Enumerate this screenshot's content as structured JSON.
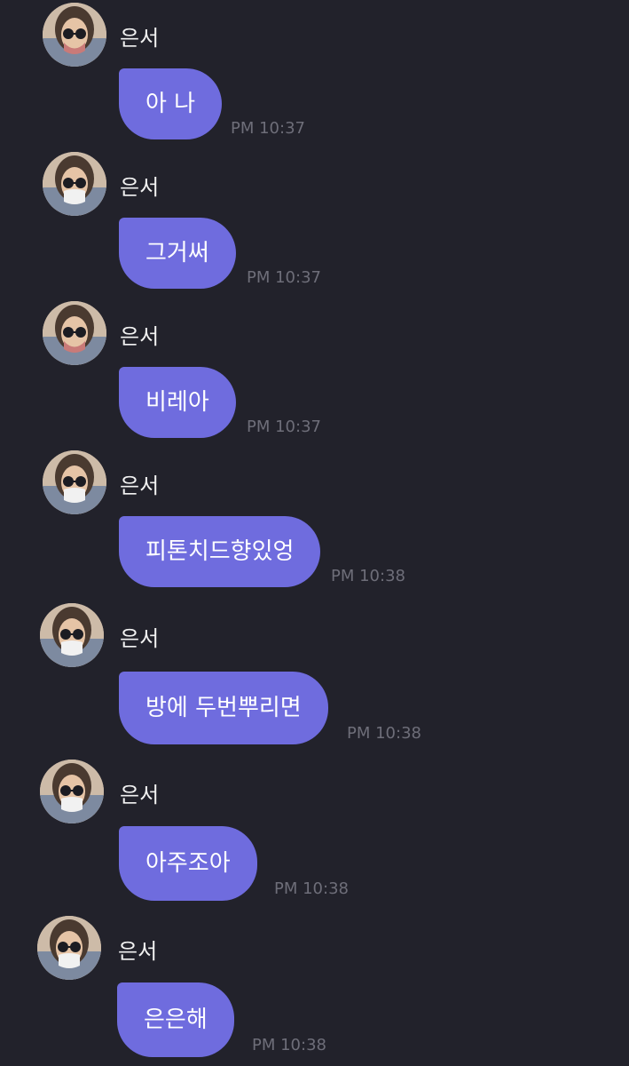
{
  "messages": [
    {
      "sender": "은서",
      "text": "아 나",
      "time": "PM 10:37"
    },
    {
      "sender": "은서",
      "text": "그거써",
      "time": "PM 10:37"
    },
    {
      "sender": "은서",
      "text": "비레아",
      "time": "PM 10:37"
    },
    {
      "sender": "은서",
      "text": "피톤치드향있엉",
      "time": "PM 10:38"
    },
    {
      "sender": "은서",
      "text": "방에 두번뿌리면",
      "time": "PM 10:38"
    },
    {
      "sender": "은서",
      "text": "아주조아",
      "time": "PM 10:38"
    },
    {
      "sender": "은서",
      "text": "은은해",
      "time": "PM 10:38"
    }
  ]
}
